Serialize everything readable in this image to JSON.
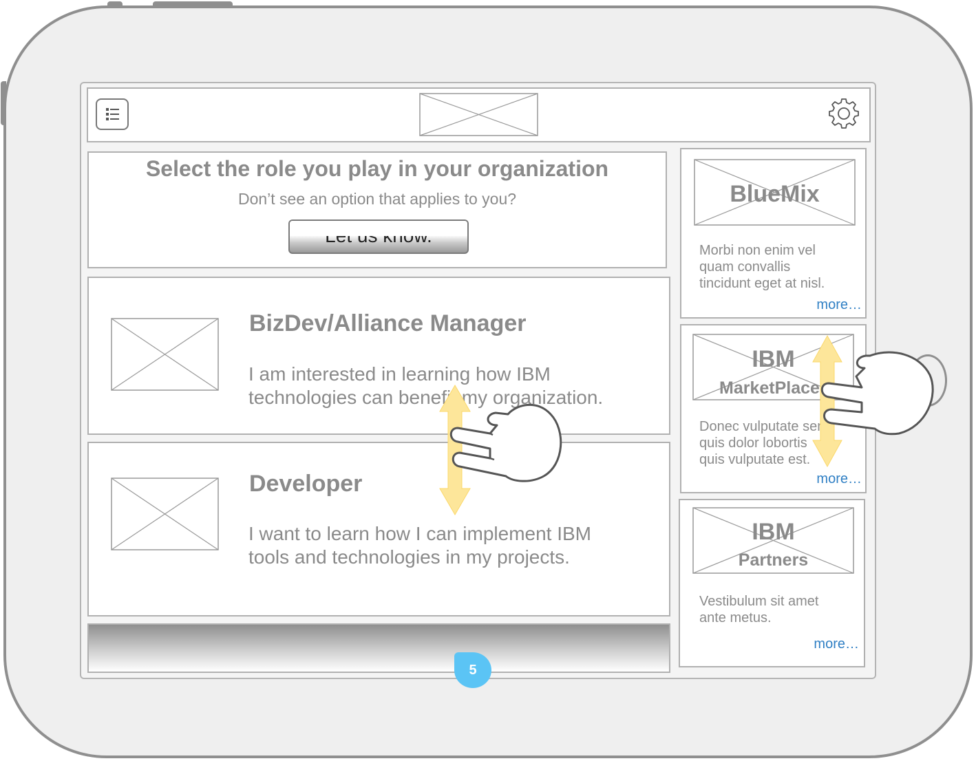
{
  "header": {
    "menu_icon": "list-icon",
    "settings_icon": "gear-icon"
  },
  "intro": {
    "title": "Select the role you play in your organization",
    "subtitle": "Don’t see an option that applies to you?",
    "button_label": "Let us know."
  },
  "roles": [
    {
      "title": "BizDev/Alliance Manager",
      "description_line1": "I am interested in learning how IBM",
      "description_line2": "technologies can benefit my organization."
    },
    {
      "title": "Developer",
      "description_line1": "I want to learn how I can implement IBM",
      "description_line2": "tools and technologies in my projects."
    }
  ],
  "side_cards": [
    {
      "title": "BlueMix",
      "subtitle": "",
      "text_line1": "Morbi non enim vel",
      "text_line2": "quam convallis",
      "text_line3": "tincidunt eget at nisl.",
      "more": "more…"
    },
    {
      "title": "IBM",
      "subtitle": "MarketPlace",
      "text_line1": "Donec vulputate sem",
      "text_line2": "quis dolor lobortis",
      "text_line3": "quis vulputate est.",
      "more": "more…"
    },
    {
      "title": "IBM",
      "subtitle": "Partners",
      "text_line1": "Vestibulum sit amet",
      "text_line2": "ante metus.",
      "text_line3": "",
      "more": "more…"
    }
  ],
  "annotation": {
    "step": "5"
  },
  "gestures": {
    "icon": "two-finger-hand-icon",
    "arrow": "vertical-scroll-arrow",
    "arrow_color": "#fde69a"
  },
  "colors": {
    "link": "#2f7fc4",
    "badge": "#5bc4f5",
    "frame": "#8f8f8f"
  }
}
